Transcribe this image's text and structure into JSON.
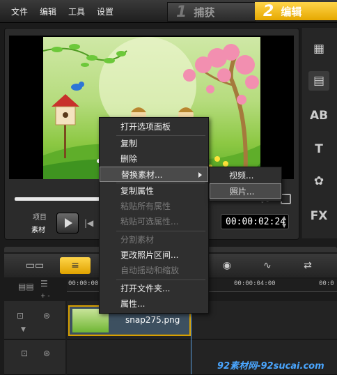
{
  "menu": [
    "文件",
    "编辑",
    "工具",
    "设置"
  ],
  "steps": {
    "capture": {
      "num": "1",
      "label": "捕获"
    },
    "edit": {
      "num": "2",
      "label": "编辑"
    }
  },
  "player": {
    "mode_project": "项目",
    "mode_clip": "素材",
    "timecode": "00:00:02:24"
  },
  "right_tools": [
    "media-icon",
    "transition-icon",
    "title-icon",
    "T",
    "graphics-icon",
    "FX"
  ],
  "timeline": {
    "ruler_labels": [
      "00:00:00",
      "00:00:04:00",
      "00:0"
    ],
    "clip_name": "snap275.png"
  },
  "context_menu": {
    "items": [
      {
        "label": "打开选项面板",
        "disabled": false
      },
      {
        "label": "复制",
        "disabled": false
      },
      {
        "label": "删除",
        "disabled": false
      },
      {
        "label": "替换素材...",
        "disabled": false,
        "submenu": true
      },
      {
        "label": "复制属性",
        "disabled": false
      },
      {
        "label": "粘贴所有属性",
        "disabled": true
      },
      {
        "label": "粘贴可选属性...",
        "disabled": true
      },
      {
        "label": "分割素材",
        "disabled": true
      },
      {
        "label": "更改照片区间...",
        "disabled": false
      },
      {
        "label": "自动摇动和缩放",
        "disabled": true
      },
      {
        "label": "打开文件夹...",
        "disabled": false
      },
      {
        "label": "属性...",
        "disabled": false
      }
    ],
    "submenu": [
      "视频...",
      "照片..."
    ]
  },
  "watermark": "92素材网-92sucai.com"
}
